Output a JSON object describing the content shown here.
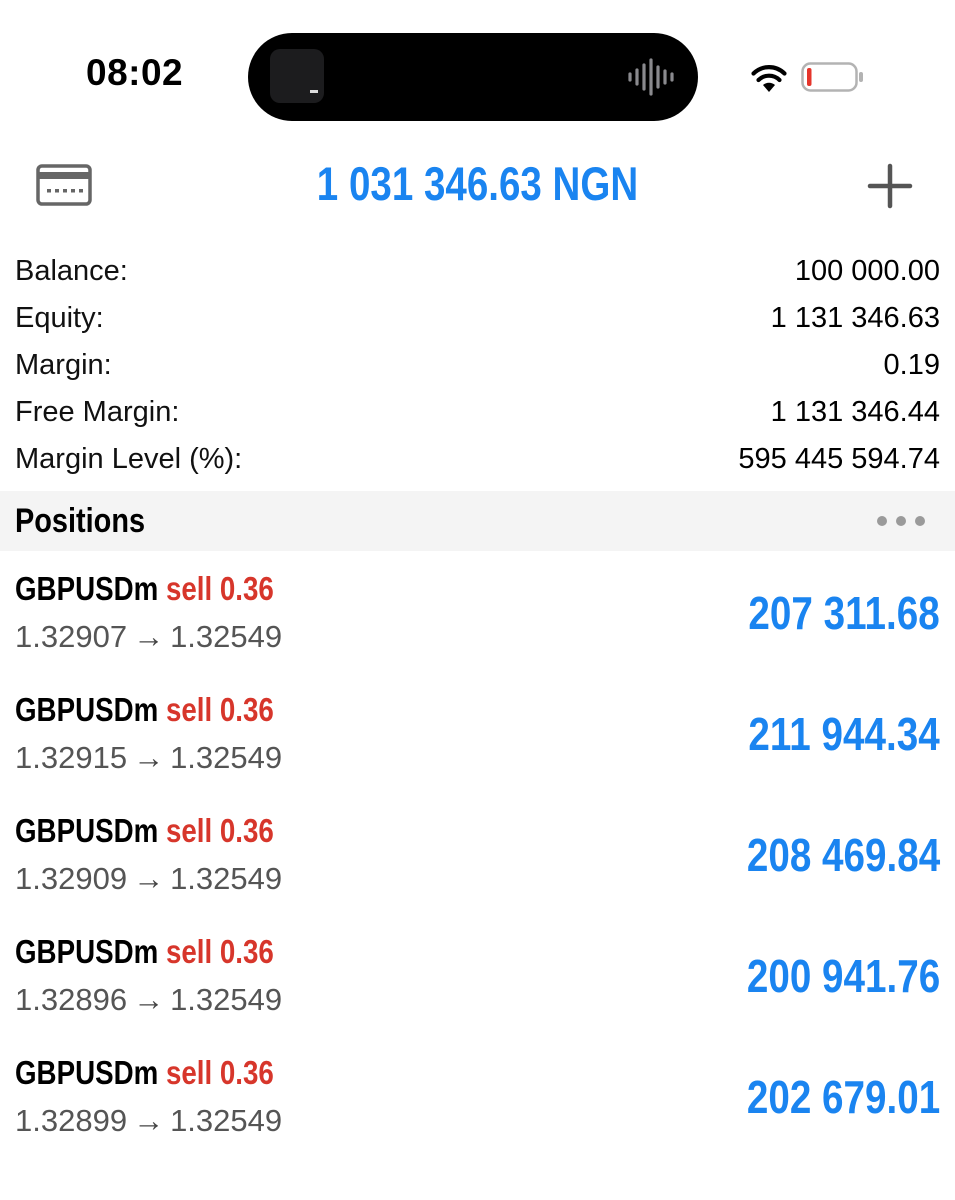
{
  "status_bar": {
    "time": "08:02"
  },
  "header": {
    "total": "1 031 346.63 NGN",
    "accent_color": "#1a84f0",
    "left_icon": "card-icon",
    "right_icon": "plus-icon"
  },
  "summary": [
    {
      "label": "Balance:",
      "value": "100 000.00"
    },
    {
      "label": "Equity:",
      "value": "1 131 346.63"
    },
    {
      "label": "Margin:",
      "value": "0.19"
    },
    {
      "label": "Free Margin:",
      "value": "1 131 346.44"
    },
    {
      "label": "Margin Level (%):",
      "value": "595 445 594.74"
    }
  ],
  "positions": {
    "title": "Positions",
    "more_icon": "more-dots-icon",
    "side_color": "#d7362b",
    "items": [
      {
        "symbol": "GBPUSDm",
        "side": "sell",
        "volume": "0.36",
        "open_price": "1.32907",
        "arrow": "→",
        "current_price": "1.32549",
        "profit": "207 311.68"
      },
      {
        "symbol": "GBPUSDm",
        "side": "sell",
        "volume": "0.36",
        "open_price": "1.32915",
        "arrow": "→",
        "current_price": "1.32549",
        "profit": "211 944.34"
      },
      {
        "symbol": "GBPUSDm",
        "side": "sell",
        "volume": "0.36",
        "open_price": "1.32909",
        "arrow": "→",
        "current_price": "1.32549",
        "profit": "208 469.84"
      },
      {
        "symbol": "GBPUSDm",
        "side": "sell",
        "volume": "0.36",
        "open_price": "1.32896",
        "arrow": "→",
        "current_price": "1.32549",
        "profit": "200 941.76"
      },
      {
        "symbol": "GBPUSDm",
        "side": "sell",
        "volume": "0.36",
        "open_price": "1.32899",
        "arrow": "→",
        "current_price": "1.32549",
        "profit": "202 679.01"
      }
    ]
  }
}
